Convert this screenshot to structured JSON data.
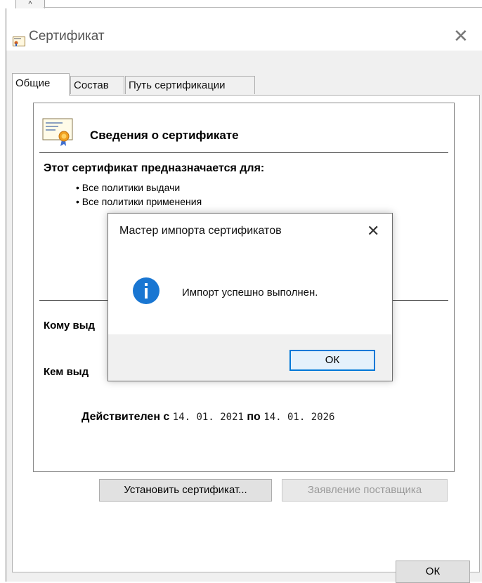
{
  "window": {
    "title": "Сертификат",
    "close_glyph": "✕",
    "scroll_up_glyph": "^"
  },
  "tabs": [
    {
      "label": "Общие",
      "active": true
    },
    {
      "label": "Состав",
      "active": false
    },
    {
      "label": "Путь сертификации",
      "active": false
    }
  ],
  "info": {
    "icon": "certificate-icon",
    "title": "Сведения о сертификате",
    "purpose_heading": "Этот сертификат предназначается для:",
    "purposes": [
      "Все политики выдачи",
      "Все политики применения"
    ],
    "issued_to_label": "Кому выд",
    "issued_by_label": "Кем выд",
    "valid_from_label": "Действителен с",
    "valid_from": "14. 01. 2021",
    "valid_to_label": "по",
    "valid_to": "14. 01. 2026"
  },
  "buttons": {
    "install_cert": "Установить сертификат...",
    "issuer_statement": "Заявление поставщика",
    "ok": "ОК"
  },
  "modal": {
    "title": "Мастер импорта сертификатов",
    "close_glyph": "✕",
    "icon": "info-icon",
    "message": "Импорт успешно выполнен.",
    "ok": "ОК"
  },
  "colors": {
    "accent": "#0078d7",
    "window_bg": "#f0f0f0",
    "panel_bg": "#ffffff"
  }
}
